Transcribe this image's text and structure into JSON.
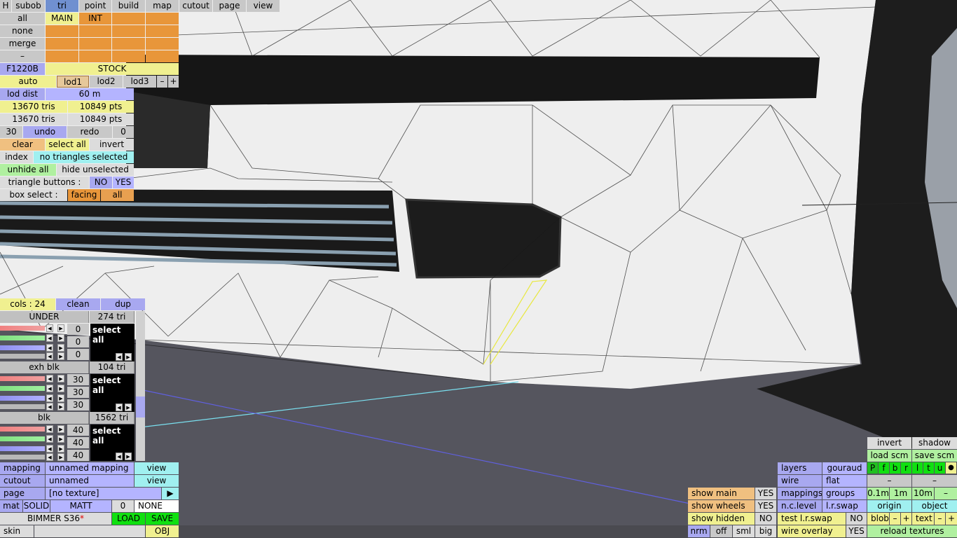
{
  "menu": {
    "h": "H",
    "subob": "subob",
    "tri": "tri",
    "point": "point",
    "build": "build",
    "map": "map",
    "cutout": "cutout",
    "page": "page",
    "view": "view"
  },
  "layers_panel": {
    "all": "all",
    "none": "none",
    "merge": "merge",
    "minus": "–",
    "main": "MAIN",
    "int": "INT"
  },
  "model": {
    "code": "F1220B",
    "variant": "STOCK"
  },
  "lod": {
    "auto": "auto",
    "lod1": "lod1",
    "lod2": "lod2",
    "lod3": "lod3",
    "minus": "–",
    "plus": "+",
    "dist_label": "lod dist",
    "dist_value": "60 m"
  },
  "stats": {
    "tris1": "13670 tris",
    "pts1": "10849 pts",
    "tris2": "13670 tris",
    "pts2": "10849 pts"
  },
  "history": {
    "count": "30",
    "undo": "undo",
    "redo": "redo",
    "redo_count": "0"
  },
  "selection": {
    "clear": "clear",
    "select_all": "select all",
    "invert": "invert",
    "index": "index",
    "status": "no triangles selected",
    "unhide_all": "unhide all",
    "hide_unselected": "hide unselected",
    "triangle_buttons": "triangle buttons :",
    "no": "NO",
    "yes": "YES",
    "box_select": "box select :",
    "facing": "facing",
    "all": "all"
  },
  "colors": {
    "cols": "cols : 24",
    "clean": "clean",
    "dup": "dup"
  },
  "groups": [
    {
      "name": "UNDER",
      "tris": "274 tri",
      "vals": [
        "0",
        "0",
        "0"
      ],
      "select_all": "select all"
    },
    {
      "name": "exh blk",
      "tris": "104 tri",
      "vals": [
        "30",
        "30",
        "30"
      ],
      "select_all": "select all"
    },
    {
      "name": "blk",
      "tris": "1562 tri",
      "vals": [
        "40",
        "40",
        "40"
      ],
      "select_all": "select all"
    }
  ],
  "mapping": {
    "mapping": "mapping",
    "mapping_name": "unnamed mapping",
    "view": "view",
    "cutout": "cutout",
    "cutout_name": "unnamed",
    "view2": "view",
    "page": "page",
    "page_name": "[no texture]",
    "page_arrow": "▶"
  },
  "material": {
    "mat": "mat",
    "solid": "SOLID",
    "matt": "MATT",
    "num": "0",
    "none": "NONE"
  },
  "file": {
    "name": "BIMMER S36",
    "mod_star": "*",
    "load": "LOAD",
    "save": "SAVE",
    "skin": "skin",
    "obj": "OBJ"
  },
  "view_opts": {
    "show_main": "show main",
    "show_main_v": "YES",
    "show_wheels": "show wheels",
    "show_wheels_v": "YES",
    "show_hidden": "show hidden",
    "show_hidden_v": "NO",
    "nrm": "nrm",
    "off": "off",
    "sml": "sml",
    "big": "big"
  },
  "render": {
    "layers": "layers",
    "gouraud": "gouraud",
    "wire": "wire",
    "flat": "flat",
    "mappings": "mappings",
    "groups": "groups",
    "nclevel": "n.c.level",
    "lrswap": "l.r.swap",
    "test_lrswap": "test l.r.swap",
    "test_lrswap_v": "NO",
    "wire_overlay": "wire overlay",
    "wire_overlay_v": "YES"
  },
  "scene": {
    "invert": "invert",
    "shadow": "shadow",
    "load_scm": "load scm",
    "save_scm": "save scm",
    "pflags": [
      "P",
      "f",
      "b",
      "r",
      "l",
      "t",
      "u"
    ],
    "dot": "●",
    "dash1": "–",
    "dash2": "–",
    "s01": "0.1m",
    "s1": "1m",
    "s10": "10m",
    "sminus": "–",
    "origin": "origin",
    "object": "object",
    "blob": "blob",
    "text": "text",
    "minus": "–",
    "plus": "+",
    "reload": "reload textures"
  }
}
